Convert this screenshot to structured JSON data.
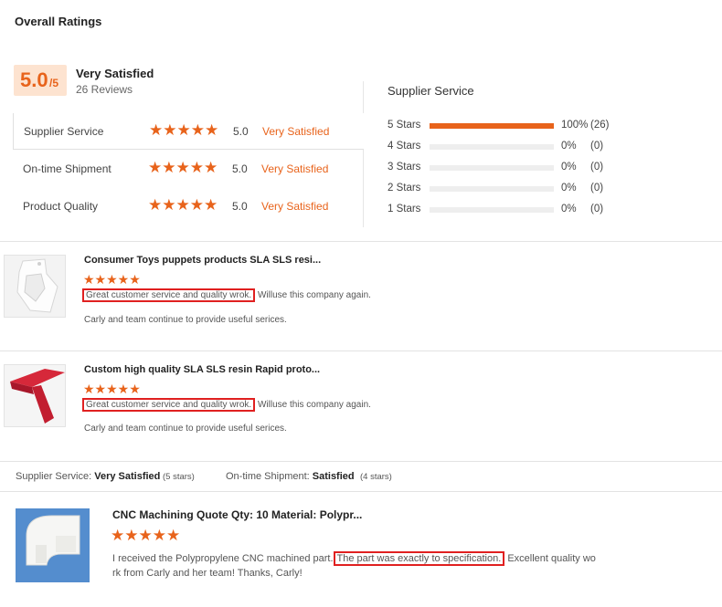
{
  "page": {
    "title": "Overall Ratings"
  },
  "overall": {
    "score": "5.0",
    "out_of": "/5",
    "label": "Very Satisfied",
    "count": "26 Reviews"
  },
  "ratings": [
    {
      "label": "Supplier Service",
      "value": "5.0",
      "text": "Very Satisfied"
    },
    {
      "label": "On-time Shipment",
      "value": "5.0",
      "text": "Very Satisfied"
    },
    {
      "label": "Product Quality",
      "value": "5.0",
      "text": "Very Satisfied"
    }
  ],
  "stars_glyph": "★★★★★",
  "distribution": {
    "title": "Supplier Service",
    "rows": [
      {
        "label": "5 Stars",
        "fraction": 1.0,
        "pct": "100%",
        "count": "(26)"
      },
      {
        "label": "4 Stars",
        "fraction": 0,
        "pct": "0%",
        "count": "(0)"
      },
      {
        "label": "3 Stars",
        "fraction": 0,
        "pct": "0%",
        "count": "(0)"
      },
      {
        "label": "2 Stars",
        "fraction": 0,
        "pct": "0%",
        "count": "(0)"
      },
      {
        "label": "1 Stars",
        "fraction": 0,
        "pct": "0%",
        "count": "(0)"
      }
    ]
  },
  "reviews": [
    {
      "title": "Consumer Toys puppets products SLA SLS resi...",
      "highlight": "Great customer service and quality wrok.",
      "rest": " Willuse this company again.",
      "line2": "Carly and team continue to provide useful serices."
    },
    {
      "title": "Custom high quality SLA SLS resin Rapid proto...",
      "highlight": "Great customer service and quality wrok.",
      "rest": " Willuse this company again.",
      "line2": "Carly and team continue to provide useful serices."
    }
  ],
  "summary": {
    "service_label": "Supplier Service:",
    "service_value": "Very Satisfied",
    "service_stars": "(5 stars)",
    "shipment_label": "On-time Shipment:",
    "shipment_value": "Satisfied",
    "shipment_stars": "(4 stars)"
  },
  "featured": {
    "title": "CNC Machining Quote Qty: 10 Material: Polypr...",
    "text_before": "I received the Polypropylene CNC machined part.",
    "highlight": "The part was exactly to specification.",
    "text_after": " Excellent quality wo",
    "line2": "rk from Carly and her team! Thanks, Carly!"
  },
  "colors": {
    "accent": "#e8631b",
    "highlight_border": "#e02020",
    "score_bg": "#fde3d0"
  }
}
